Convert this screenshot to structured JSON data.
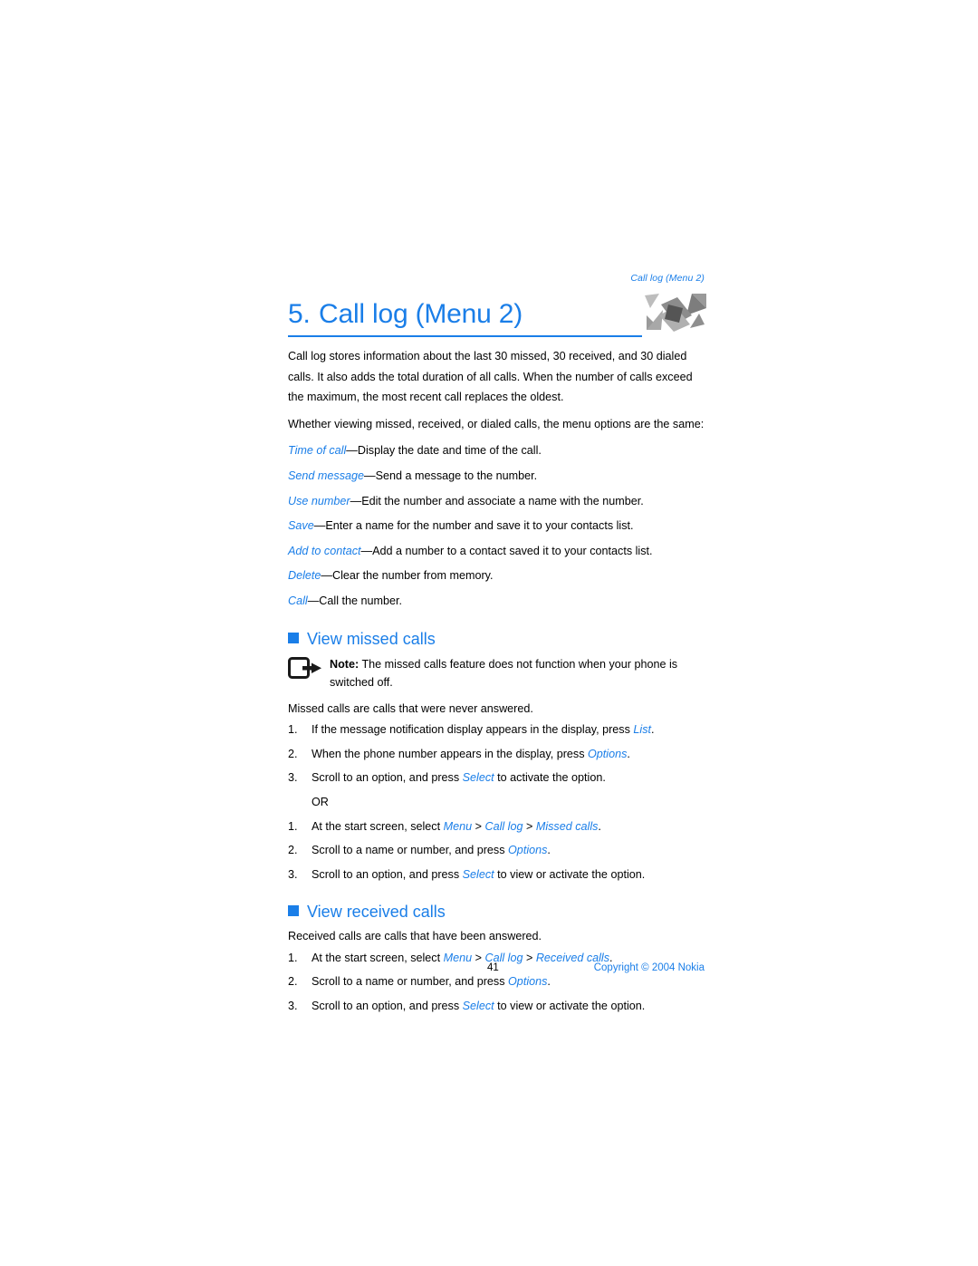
{
  "header": {
    "running_head": "Call log (Menu 2)"
  },
  "title": {
    "number": "5.",
    "text": "Call log (Menu 2)",
    "icon": "crossed-call-arrows-icon",
    "accent_color": "#1a7ee8"
  },
  "intro": {
    "paragraph_1": "Call log stores information about the last 30 missed, 30 received, and 30 dialed calls. It also adds the total duration of all calls. When the number of calls exceed the maximum, the most recent call replaces the oldest.",
    "paragraph_2": "Whether viewing missed, received, or dialed calls, the menu options are the same:"
  },
  "options": [
    {
      "term": "Time of call",
      "dash": "—",
      "description": "Display the date and time of the call."
    },
    {
      "term": "Send message",
      "dash": "—",
      "description": "Send a message to the number."
    },
    {
      "term": "Use number",
      "dash": "—",
      "description": "Edit the number and associate a name with the number."
    },
    {
      "term": "Save",
      "dash": "—",
      "description": "Enter a name for the number and save it to your contacts list."
    },
    {
      "term": "Add to contact",
      "dash": "—",
      "description": "Add a number to a contact saved it to your contacts list."
    },
    {
      "term": "Delete",
      "dash": "—",
      "description": "Clear the number from memory."
    },
    {
      "term": "Call",
      "dash": "—",
      "description": "Call the number."
    }
  ],
  "missed": {
    "heading": "View missed calls",
    "note": {
      "icon": "note-arrow-icon",
      "label": "Note:",
      "text": " The missed calls feature does not function when your phone is switched off."
    },
    "lead": "Missed calls are calls that were never answered.",
    "steps_a": [
      {
        "marker": "1.",
        "pre": "If the message notification display appears in the display, press ",
        "key": "List",
        "post": "."
      },
      {
        "marker": "2.",
        "pre": "When the phone number appears in the display, press ",
        "key": "Options",
        "post": "."
      },
      {
        "marker": "3.",
        "pre": "Scroll to an option, and press ",
        "key": "Select",
        "post": " to activate the option."
      }
    ],
    "or_label": "OR",
    "steps_b": [
      {
        "marker": "1.",
        "pre": "At the start screen, select ",
        "path": [
          "Menu",
          "Call log",
          "Missed calls"
        ],
        "post": "."
      },
      {
        "marker": "2.",
        "pre": "Scroll to a name or number, and press ",
        "key": "Options",
        "post": "."
      },
      {
        "marker": "3.",
        "pre": "Scroll to an option, and press ",
        "key": "Select",
        "post": " to view or activate the option."
      }
    ]
  },
  "received": {
    "heading": "View received calls",
    "lead": "Received calls are calls that have been answered.",
    "steps": [
      {
        "marker": "1.",
        "pre": "At the start screen, select ",
        "path": [
          "Menu",
          "Call log",
          "Received calls"
        ],
        "post": "."
      },
      {
        "marker": "2.",
        "pre": "Scroll to a name or number, and press ",
        "key": "Options",
        "post": "."
      },
      {
        "marker": "3.",
        "pre": "Scroll to an option, and press ",
        "key": "Select",
        "post": " to view or activate the option."
      }
    ]
  },
  "footer": {
    "page_number": "41",
    "copyright": "Copyright © 2004 Nokia"
  },
  "path_separator": " > "
}
